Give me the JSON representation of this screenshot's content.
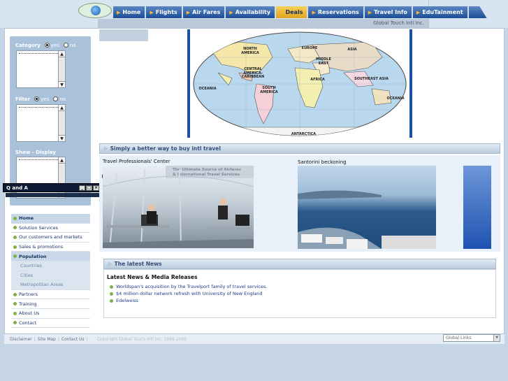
{
  "header": {
    "company": "Global Touch Intl Inc.",
    "nav": [
      {
        "label": "Home",
        "active": false
      },
      {
        "label": "Flights",
        "active": false
      },
      {
        "label": "Air Fares",
        "active": false
      },
      {
        "label": "Availability",
        "active": false
      },
      {
        "label": "Deals",
        "active": true
      },
      {
        "label": "Reservations",
        "active": false
      },
      {
        "label": "Travel Info",
        "active": false
      },
      {
        "label": "EduTainment",
        "active": false
      }
    ]
  },
  "filters": {
    "category": {
      "label": "Category",
      "yes": "yes",
      "no": "no",
      "selected": "yes"
    },
    "filter": {
      "label": "Filter",
      "yes": "yes",
      "no": "no",
      "selected": "yes"
    },
    "show": {
      "label": "Show - Display"
    }
  },
  "qa_popup": {
    "title": "Q and A"
  },
  "menu": [
    {
      "label": "Home",
      "style": "hl"
    },
    {
      "label": "Solution Services",
      "style": "normal"
    },
    {
      "label": "Our customers and markets",
      "style": "normal"
    },
    {
      "label": "Sales & promotions",
      "style": "normal"
    },
    {
      "label": "Population",
      "style": "hl"
    },
    {
      "label": "Countries",
      "style": "sub"
    },
    {
      "label": "Cities",
      "style": "sub"
    },
    {
      "label": "Metropolitan Areas",
      "style": "sub"
    },
    {
      "label": "Partners",
      "style": "normal"
    },
    {
      "label": "Training",
      "style": "normal"
    },
    {
      "label": "About Us",
      "style": "normal"
    },
    {
      "label": "Contact",
      "style": "normal"
    }
  ],
  "map": {
    "labels": [
      "NORTH AMERICA",
      "EUROPE",
      "ASIA",
      "MIDDLE EAST",
      "CENTRAL AMERICA-CARIBBEAN",
      "AFRICA",
      "SOUTHEAST ASIA",
      "OCEANIA",
      "SOUTH AMERICA",
      "OCEANIA",
      "ANTARCTICA"
    ]
  },
  "tagline": "Simply a better way to buy intl travel",
  "photos": {
    "left_title": "Travel Professionals' Center",
    "left_slogan_1": "The Ultimate Source of Airfares",
    "left_slogan_2": "& International Travel Services",
    "right_title": "Santorini beckoning"
  },
  "news": {
    "section_title": "The latest News",
    "heading": "Latest News & Media Releases",
    "items": [
      "Worldspan's acquisition by the Travelport family of travel services.",
      "$4 million dollar network refresh with University of New England",
      "Edelweiss"
    ]
  },
  "footer": {
    "links": [
      "Disclaimer",
      "Site Map",
      "Contact Us"
    ],
    "copyright": "Copyright Global Touch Intl Inc. 1996-2009",
    "global_links": "Global Links"
  }
}
